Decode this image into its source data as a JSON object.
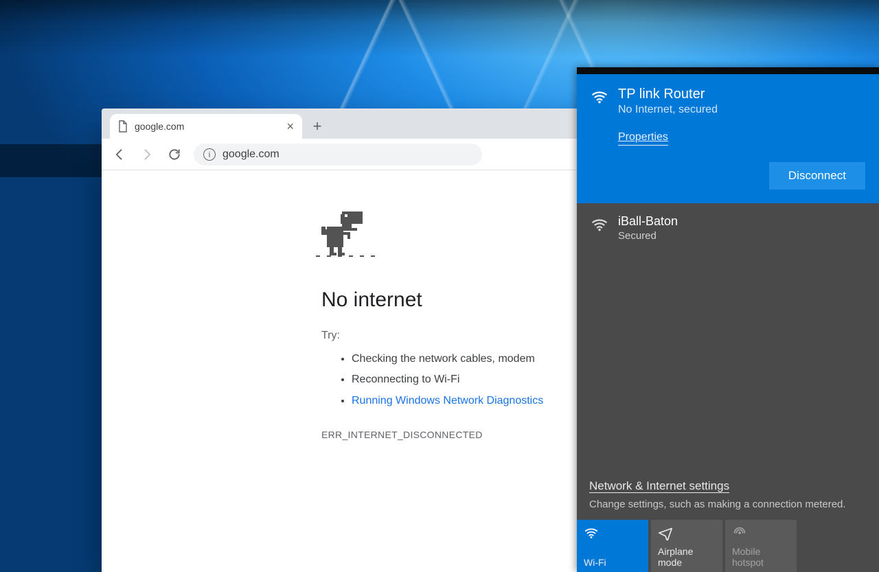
{
  "browser": {
    "tab": {
      "title": "google.com"
    },
    "omnibox": {
      "url": "google.com"
    },
    "error": {
      "heading": "No internet",
      "try_label": "Try:",
      "tips": {
        "a": "Checking the network cables, modem",
        "b": "Reconnecting to Wi-Fi",
        "c": "Running Windows Network Diagnostics"
      },
      "code": "ERR_INTERNET_DISCONNECTED"
    }
  },
  "network": {
    "active": {
      "name": "TP link Router",
      "status": "No Internet, secured",
      "properties": "Properties",
      "disconnect": "Disconnect"
    },
    "other": {
      "name": "iBall-Baton",
      "status": "Secured"
    },
    "settings_link": "Network & Internet settings",
    "settings_desc": "Change settings, such as making a connection metered.",
    "tiles": {
      "wifi": "Wi-Fi",
      "airplane": "Airplane mode",
      "hotspot_a": "Mobile",
      "hotspot_b": "hotspot"
    }
  }
}
